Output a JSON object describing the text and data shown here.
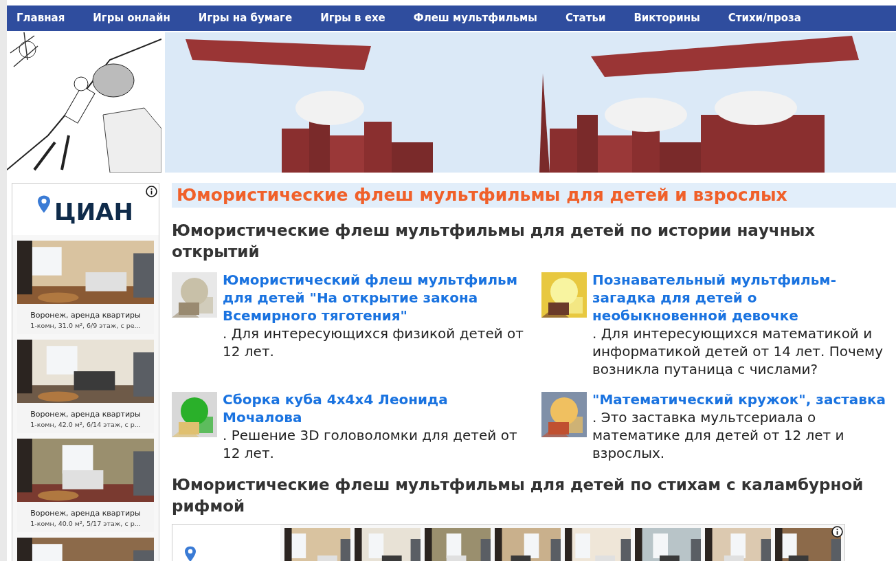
{
  "nav": [
    {
      "label": "Главная"
    },
    {
      "label": "Игры онлайн"
    },
    {
      "label": "Игры на бумаге"
    },
    {
      "label": "Игры в exe"
    },
    {
      "label": "Флеш мультфильмы"
    },
    {
      "label": "Статьи"
    },
    {
      "label": "Викторины"
    },
    {
      "label": "Стихи/проза"
    }
  ],
  "side_ad": {
    "logo": "ЦИАН",
    "listings": [
      {
        "title": "Воронеж, аренда квартиры",
        "details": "1-комн, 31.0 м², 6/9 этаж, с ре..."
      },
      {
        "title": "Воронеж, аренда квартиры",
        "details": "1-комн, 42.0 м², 6/14 этаж, с р..."
      },
      {
        "title": "Воронеж, аренда квартиры",
        "details": "1-комн, 40.0 м², 5/17 этаж, с р..."
      }
    ]
  },
  "page_title": "Юмористические флеш мультфильмы для детей и взрослых",
  "sections": [
    {
      "heading": "Юмористические флеш мультфильмы для детей по истории научных открытий",
      "items": [
        {
          "title": "Юмористический флеш мультфильм для детей \"На открытие закона Всемирного тяготения\"",
          "description": ". Для интересующихся физикой детей от 12 лет."
        },
        {
          "title": "Познавательный мультфильм-загадка для детей о необыкновенной девочке",
          "description": ". Для интересующихся математикой и информатикой детей от 14 лет. Почему возникла путаница с числами?"
        },
        {
          "title": "Сборка куба 4x4x4 Леонида Мочалова",
          "description": ". Решение 3D головоломки для детей от 12 лет."
        },
        {
          "title": "\"Математический кружок\", заставка",
          "description": ". Это заставка мультсериала о математике для детей от 12 лет и взрослых."
        }
      ]
    },
    {
      "heading": "Юмористические флеш мультфильмы для детей по стихам с каламбурной рифмой"
    }
  ]
}
